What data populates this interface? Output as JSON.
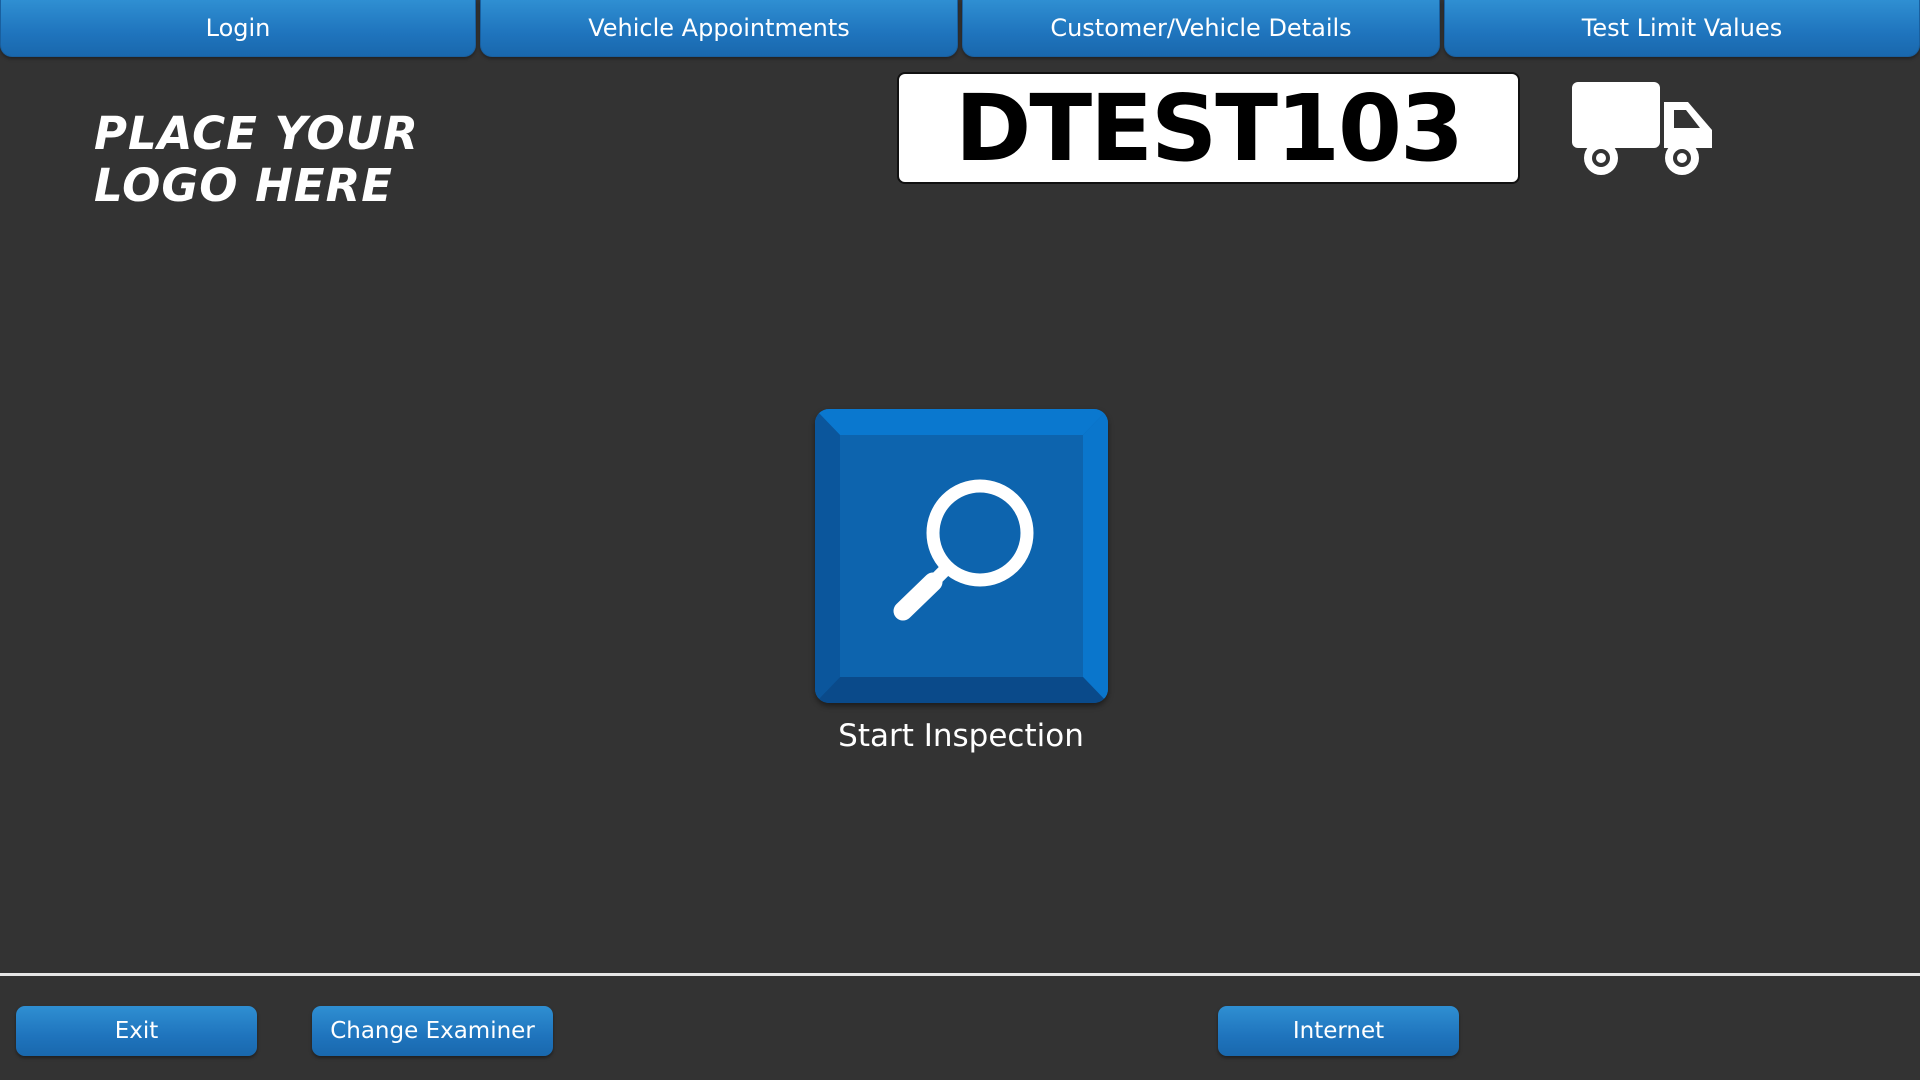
{
  "tabs": [
    {
      "label": "Login"
    },
    {
      "label": "Vehicle Appointments"
    },
    {
      "label": "Customer/Vehicle Details"
    },
    {
      "label": "Test Limit Values"
    }
  ],
  "logo": {
    "line1": "PLACE YOUR",
    "line2": "LOGO HERE"
  },
  "vehicle": {
    "plate": "DTEST103",
    "type_icon": "truck-icon"
  },
  "main": {
    "start_inspection_label": "Start Inspection",
    "start_inspection_icon": "magnifier-icon"
  },
  "footer": {
    "exit_label": "Exit",
    "change_examiner_label": "Change Examiner",
    "internet_label": "Internet"
  },
  "colors": {
    "background": "#333333",
    "accent_blue": "#1f74bd",
    "inspect_button": "#0d5ea8",
    "plate_background": "#ffffff"
  }
}
